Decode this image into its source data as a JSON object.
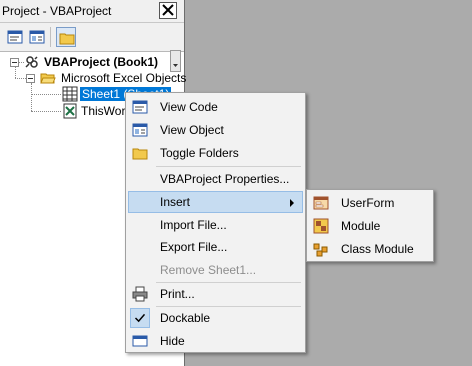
{
  "pane": {
    "title": "Project - VBAProject"
  },
  "tree": {
    "project": "VBAProject (Book1)",
    "folder": "Microsoft Excel Objects",
    "sheet1": "Sheet1 (Sheet1)",
    "workbook": "ThisWork"
  },
  "menu": {
    "view_code": "View Code",
    "view_object": "View Object",
    "toggle_folders": "Toggle Folders",
    "properties": "VBAProject Properties...",
    "insert": "Insert",
    "import": "Import File...",
    "export": "Export File...",
    "remove": "Remove Sheet1...",
    "print": "Print...",
    "dockable": "Dockable",
    "hide": "Hide"
  },
  "submenu": {
    "userform": "UserForm",
    "module": "Module",
    "class_module": "Class Module"
  },
  "colors": {
    "selection": "#0078d7",
    "menu_highlight": "#c6dcf1",
    "workspace": "#ababab"
  }
}
